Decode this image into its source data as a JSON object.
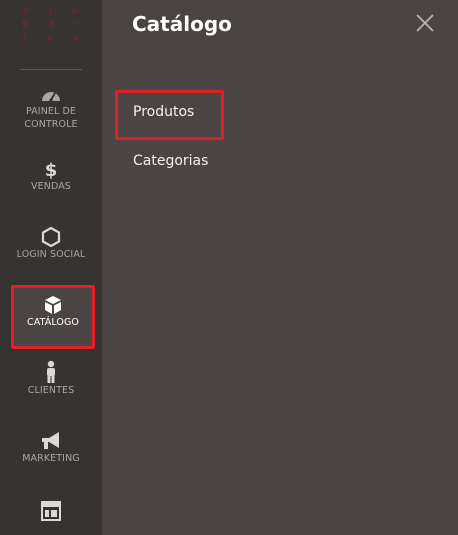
{
  "logo": {
    "lines": [
      "S I G",
      "N A T",
      "I V A"
    ]
  },
  "sidebar": {
    "items": [
      {
        "label_1": "PAINEL DE",
        "label_2": "CONTROLE",
        "icon": "dashboard-icon"
      },
      {
        "label_1": "VENDAS",
        "icon": "dollar-icon"
      },
      {
        "label_1": "LOGIN SOCIAL",
        "icon": "hexagon-icon"
      },
      {
        "label_1": "CATÁLOGO",
        "icon": "box-icon",
        "active": true
      },
      {
        "label_1": "CLIENTES",
        "icon": "person-icon"
      },
      {
        "label_1": "MARKETING",
        "icon": "megaphone-icon"
      },
      {
        "label_1": "",
        "icon": "layout-icon"
      }
    ]
  },
  "panel": {
    "title": "Catálogo",
    "links": [
      "Produtos",
      "Categorias"
    ]
  },
  "colors": {
    "highlight": "#e31e25",
    "sidebar_bg": "#373330",
    "panel_bg": "#4a4542"
  }
}
